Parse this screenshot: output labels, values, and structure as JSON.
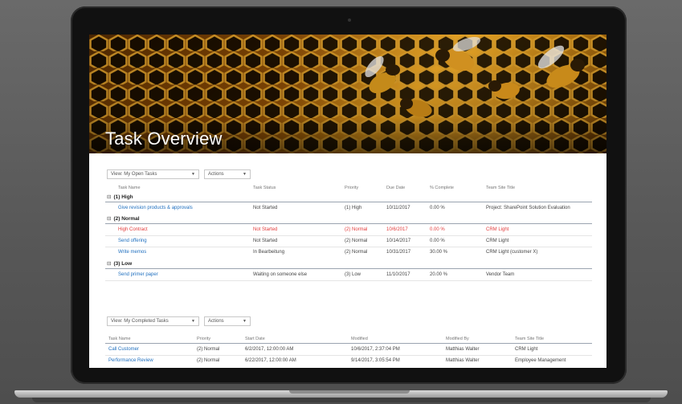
{
  "banner": {
    "title": "Task Overview"
  },
  "open_tasks": {
    "view_select": "View: My Open Tasks",
    "actions_select": "Actions",
    "columns": [
      "Task Name",
      "Task Status",
      "Priority",
      "Due Date",
      "% Complete",
      "Team Site Title"
    ],
    "groups": [
      {
        "label": "(1) High",
        "toggle": "⊟",
        "rows": [
          {
            "name": "Give revision products & approvals",
            "status": "Not Started",
            "priority": "(1) High",
            "due": "10/11/2017",
            "complete": "0.00 %",
            "site": "Project: SharePoint Solution Evaluation",
            "overdue": false
          }
        ]
      },
      {
        "label": "(2) Normal",
        "toggle": "⊟",
        "rows": [
          {
            "name": "High Contract",
            "status": "Not Started",
            "priority": "(2) Normal",
            "due": "10/6/2017",
            "complete": "0.00 %",
            "site": "CRM Light",
            "overdue": true
          },
          {
            "name": "Send offering",
            "status": "Not Started",
            "priority": "(2) Normal",
            "due": "10/14/2017",
            "complete": "0.00 %",
            "site": "CRM Light",
            "overdue": false
          },
          {
            "name": "Write memos",
            "status": "In Bearbeitung",
            "priority": "(2) Normal",
            "due": "10/31/2017",
            "complete": "30.00 %",
            "site": "CRM Light (customer X)",
            "overdue": false
          }
        ]
      },
      {
        "label": "(3) Low",
        "toggle": "⊟",
        "rows": [
          {
            "name": "Send primer paper",
            "status": "Waiting on someone else",
            "priority": "(3) Low",
            "due": "11/10/2017",
            "complete": "20.00 %",
            "site": "Vendor Team",
            "overdue": false
          }
        ]
      }
    ]
  },
  "completed_tasks": {
    "view_select": "View: My Completed Tasks",
    "actions_select": "Actions",
    "columns": [
      "Task Name",
      "Priority",
      "Start Date",
      "Modified",
      "Modified By",
      "Team Site Title"
    ],
    "rows": [
      {
        "name": "Call Customer",
        "priority": "(2) Normal",
        "start": "6/2/2017, 12:00:00 AM",
        "modified": "10/6/2017, 2:37:04 PM",
        "by": "Matthias Walter",
        "site": "CRM Light"
      },
      {
        "name": "Performance Review",
        "priority": "(2) Normal",
        "start": "6/22/2017, 12:00:00 AM",
        "modified": "9/14/2017, 3:05:54 PM",
        "by": "Matthias Walter",
        "site": "Employee Management"
      }
    ]
  },
  "colors": {
    "link": "#1f6fbf",
    "overdue": "#e23b3b",
    "frame": "#111111",
    "background": "#5b5b5b"
  }
}
